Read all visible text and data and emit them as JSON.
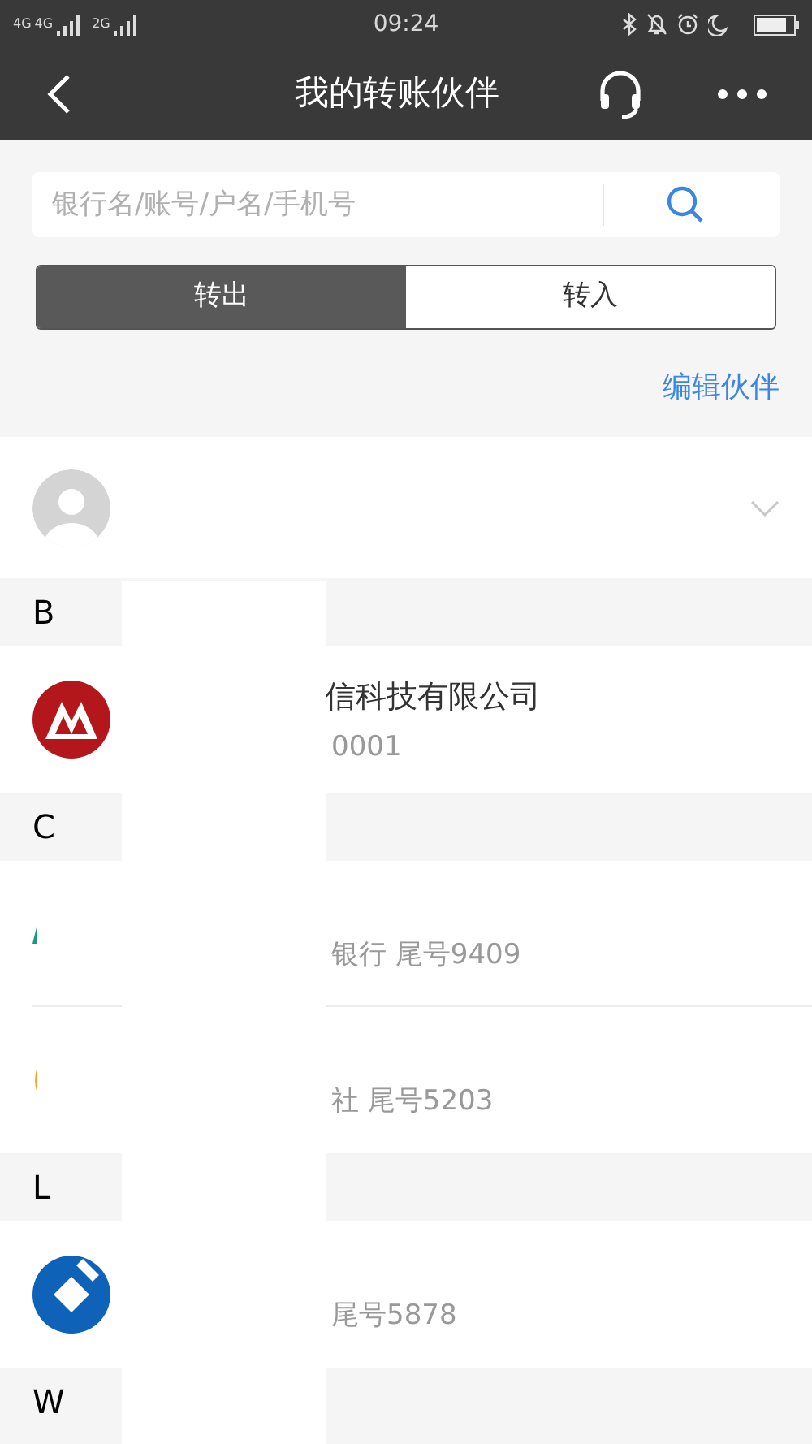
{
  "status_bar": {
    "signal_labels": [
      "4G",
      "4G",
      "2G"
    ],
    "time": "09:24"
  },
  "header": {
    "title": "我的转账伙伴"
  },
  "search": {
    "placeholder": "银行名/账号/户名/手机号"
  },
  "segments": [
    {
      "label": "转出",
      "selected": true
    },
    {
      "label": "转入",
      "selected": false
    }
  ],
  "edit_link": "编辑伙伴",
  "sections": [
    {
      "letter": "B",
      "items": [
        {
          "kind": "red",
          "name": "信科技有限公司",
          "account": "0001"
        }
      ]
    },
    {
      "letter": "C",
      "items": [
        {
          "kind": "green",
          "account": "银行 尾号9409"
        },
        {
          "kind": "orange",
          "account": "社 尾号5203"
        }
      ]
    },
    {
      "letter": "L",
      "items": [
        {
          "kind": "blue",
          "account": "尾号5878"
        }
      ]
    },
    {
      "letter": "W"
    }
  ]
}
